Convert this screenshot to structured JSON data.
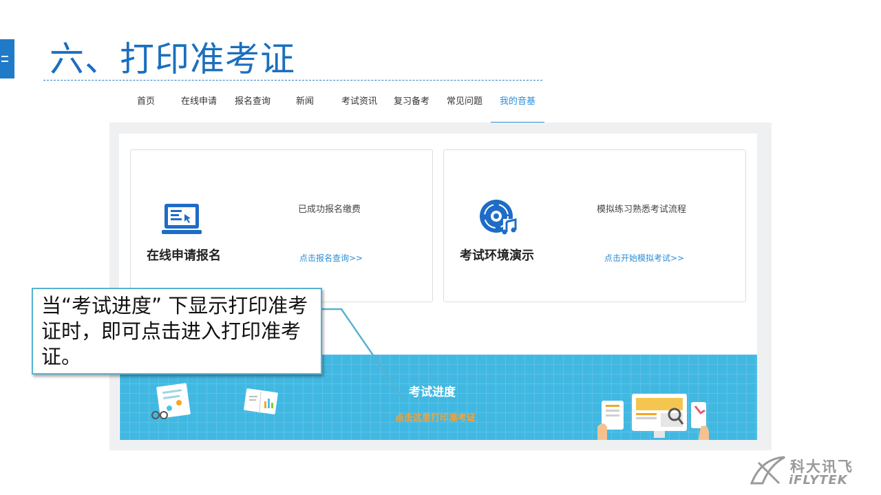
{
  "slide": {
    "title": "六、打印准考证"
  },
  "nav": {
    "items": [
      {
        "label": "首页"
      },
      {
        "label": "在线申请"
      },
      {
        "label": "报名查询"
      },
      {
        "label": "新闻"
      },
      {
        "label": "考试资讯"
      },
      {
        "label": "复习备考"
      },
      {
        "label": "常见问题"
      },
      {
        "label": "我的音基",
        "active": true
      }
    ]
  },
  "cards": [
    {
      "title": "在线申请报名",
      "desc": "已成功报名缴费",
      "link": "点击报名查询>>",
      "icon": "laptop-icon"
    },
    {
      "title": "考试环境演示",
      "desc": "模拟练习熟悉考试流程",
      "link": "点击开始模拟考试>>",
      "icon": "music-disc-icon"
    }
  ],
  "banner": {
    "title": "考试进度",
    "link": "点击这里打印准考证"
  },
  "callout": {
    "text": "当“考试进度” 下显示打印准考证时，即可点击进入打印准考证。"
  },
  "logo": {
    "cn": "科大讯飞",
    "en": "iFLYTEK"
  },
  "colors": {
    "title_blue": "#1a6fbf",
    "accent_blue": "#2b8ed8",
    "banner_bg": "#41b8e2",
    "banner_link": "#f6a33a",
    "callout_border": "#57b2d2"
  }
}
